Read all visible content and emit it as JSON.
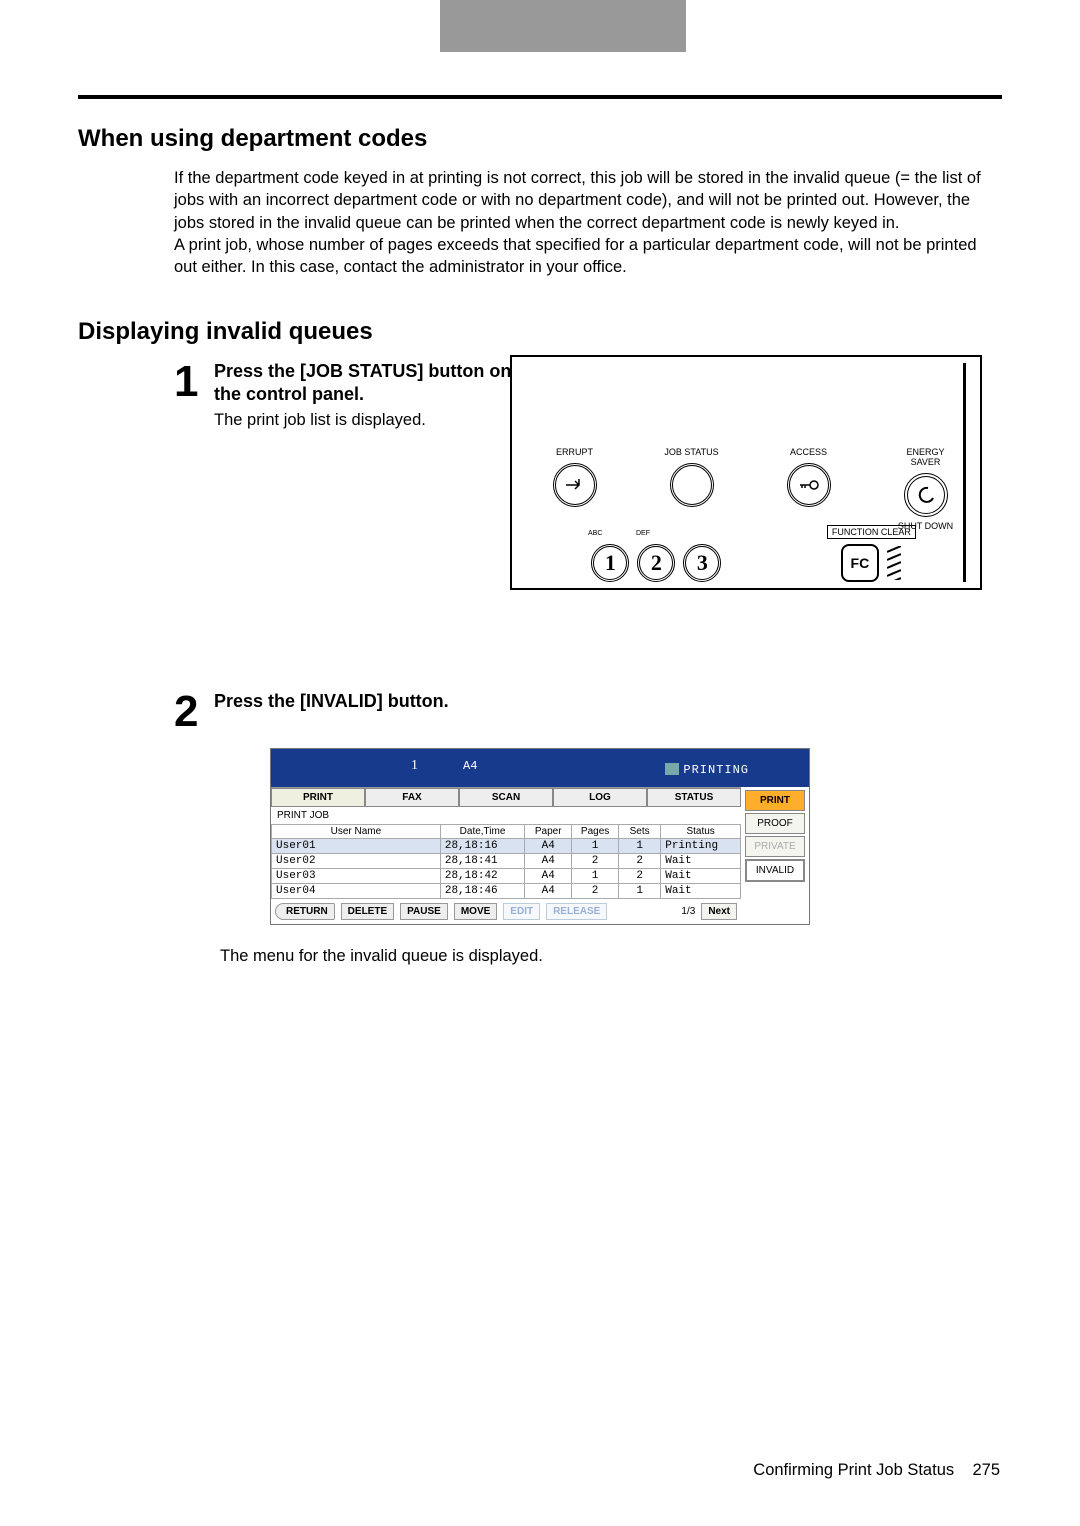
{
  "headings": {
    "main": "When using department codes",
    "sub": "Displaying invalid queues"
  },
  "paragraphs": {
    "intro": "If the department code keyed in at printing is not correct, this job will be stored in the invalid queue (= the list of jobs with an incorrect department code or with no department code), and will not be printed out. However, the jobs stored in the invalid queue can be printed when the correct department code is newly keyed in.\nA print job, whose number of pages exceeds that specified for a particular department code, will not be printed out either. In this case, contact the administrator in your office."
  },
  "steps": [
    {
      "num": "1",
      "title": "Press the [JOB STATUS] button on the control panel.",
      "sub": "The print job list is displayed."
    },
    {
      "num": "2",
      "title": "Press the [INVALID] button.",
      "after": "The menu for the invalid queue is displayed."
    }
  ],
  "panel": {
    "labels": [
      "ERRUPT",
      "JOB STATUS",
      "ACCESS",
      "ENERGY\nSAVER"
    ],
    "shutdown": "SHUT DOWN",
    "function_clear": "FUNCTION CLEAR",
    "fc": "FC",
    "abc": "ABC",
    "def": "DEF",
    "keys": [
      "1",
      "2",
      "3"
    ]
  },
  "screen": {
    "count": "1",
    "paper": "A4",
    "status_text": "PRINTING",
    "tabs": [
      "PRINT",
      "FAX",
      "SCAN",
      "LOG",
      "STATUS"
    ],
    "active_tab": 0,
    "subtitle": "PRINT JOB",
    "columns": [
      "User Name",
      "Date,Time",
      "Paper",
      "Pages",
      "Sets",
      "Status"
    ],
    "rows": [
      {
        "user": "User01",
        "dt": "28,18:16",
        "paper": "A4",
        "pages": "1",
        "sets": "1",
        "status": "Printing",
        "sel": true
      },
      {
        "user": "User02",
        "dt": "28,18:41",
        "paper": "A4",
        "pages": "2",
        "sets": "2",
        "status": "Wait"
      },
      {
        "user": "User03",
        "dt": "28,18:42",
        "paper": "A4",
        "pages": "1",
        "sets": "2",
        "status": "Wait"
      },
      {
        "user": "User04",
        "dt": "28,18:46",
        "paper": "A4",
        "pages": "2",
        "sets": "1",
        "status": "Wait"
      }
    ],
    "side": [
      "PRINT",
      "PROOF",
      "PRIVATE",
      "INVALID"
    ],
    "toolbar": [
      "RETURN",
      "DELETE",
      "PAUSE",
      "MOVE",
      "EDIT",
      "RELEASE"
    ],
    "page": "1/3",
    "next": "Next"
  },
  "footer": {
    "title": "Confirming Print Job Status",
    "page": "275"
  }
}
